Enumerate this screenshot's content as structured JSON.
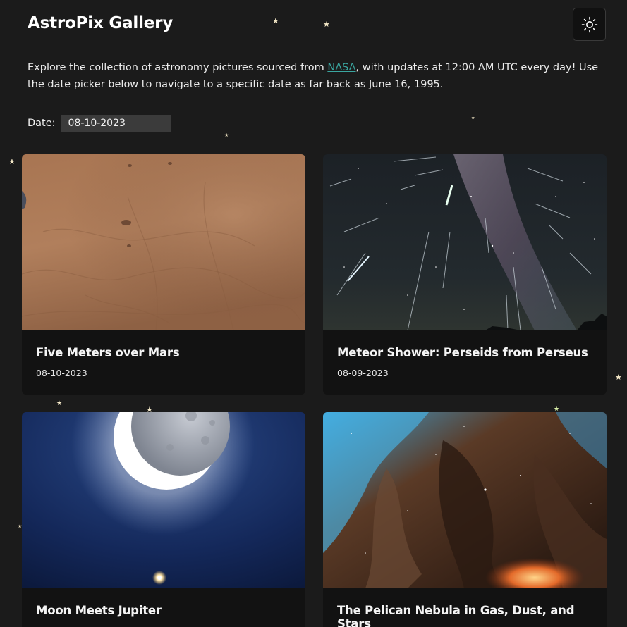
{
  "header": {
    "title": "AstroPix Gallery",
    "theme_toggle_icon": "sun-icon"
  },
  "intro": {
    "before_link": "Explore the collection of astronomy pictures sourced from ",
    "link_text": "NASA",
    "after_link": ", with updates at 12:00 AM UTC every day! Use the date picker below to navigate to a specific date as far back as June 16, 1995."
  },
  "date_picker": {
    "label": "Date:",
    "value": "08-10-2023"
  },
  "cards": [
    {
      "title": "Five Meters over Mars",
      "date": "08-10-2023"
    },
    {
      "title": "Meteor Shower: Perseids from Perseus",
      "date": "08-09-2023"
    },
    {
      "title": "Moon Meets Jupiter",
      "date": ""
    },
    {
      "title": "The Pelican Nebula in Gas, Dust, and Stars",
      "date": ""
    }
  ],
  "colors": {
    "background": "#1b1b1b",
    "card": "#121212",
    "link": "#3aa6a0",
    "input": "#3b3b3b"
  }
}
